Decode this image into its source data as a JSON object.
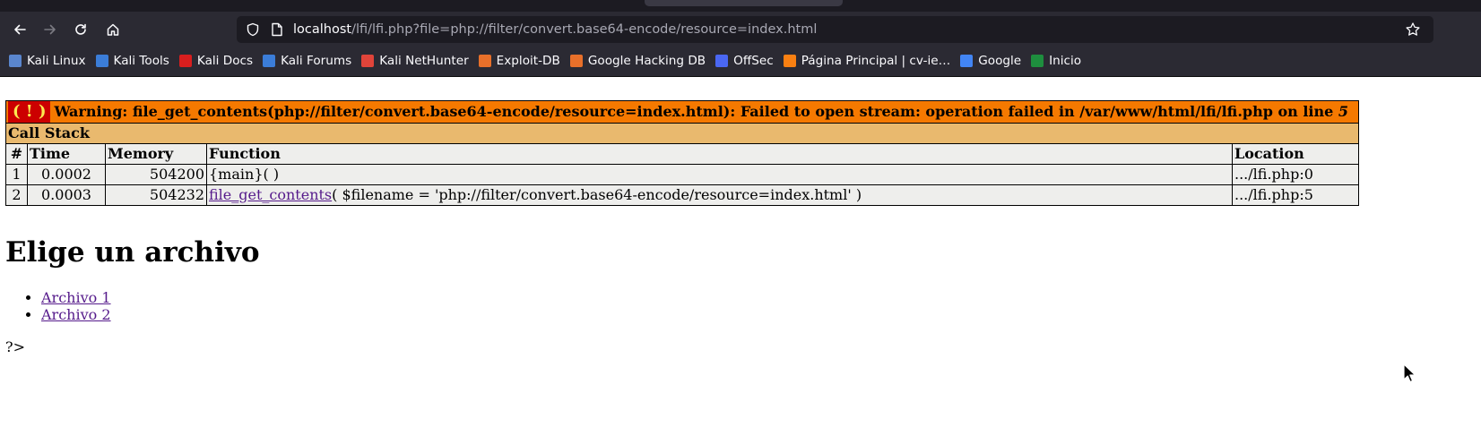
{
  "browser": {
    "url_host": "localhost",
    "url_rest": "/lfi/lfi.php?file=php://filter/convert.base64-encode/resource=index.html",
    "bookmarks": [
      {
        "label": "Kali Linux",
        "icon": "kali-dragon-icon",
        "color": "#5a86ce"
      },
      {
        "label": "Kali Tools",
        "icon": "kali-tools-icon",
        "color": "#3b7dd8"
      },
      {
        "label": "Kali Docs",
        "icon": "kali-docs-icon",
        "color": "#d81e1e"
      },
      {
        "label": "Kali Forums",
        "icon": "kali-forums-icon",
        "color": "#3b7dd8"
      },
      {
        "label": "Kali NetHunter",
        "icon": "nethunter-icon",
        "color": "#e0443a"
      },
      {
        "label": "Exploit-DB",
        "icon": "exploit-db-icon",
        "color": "#e8702a"
      },
      {
        "label": "Google Hacking DB",
        "icon": "ghdb-icon",
        "color": "#e8702a"
      },
      {
        "label": "OffSec",
        "icon": "offsec-icon",
        "color": "#4a67f2"
      },
      {
        "label": "Página Principal | cv-ie…",
        "icon": "moodle-icon",
        "color": "#f98012"
      },
      {
        "label": "Google",
        "icon": "google-icon",
        "color": "#4285f4"
      },
      {
        "label": "Inicio",
        "icon": "classroom-icon",
        "color": "#1e8e3e"
      }
    ]
  },
  "error": {
    "badge": "( ! )",
    "warning_prefix": "Warning: file_get_contents(php://filter/convert.base64-encode/resource=index.html): Failed to open stream: operation failed in /var/www/html/lfi/lfi.php on line ",
    "line_number": "5",
    "callstack_label": "Call Stack",
    "columns": [
      "#",
      "Time",
      "Memory",
      "Function",
      "Location"
    ],
    "rows": [
      {
        "num": "1",
        "time": "0.0002",
        "memory": "504200",
        "func_link": "",
        "func_text": "{main}( )",
        "location": ".../lfi.php:0"
      },
      {
        "num": "2",
        "time": "0.0003",
        "memory": "504232",
        "func_link": "file_get_contents",
        "func_text": "( $filename = 'php://filter/convert.base64-encode/resource=index.html' )",
        "location": ".../lfi.php:5"
      }
    ]
  },
  "page": {
    "heading": "Elige un archivo",
    "links": [
      "Archivo 1",
      "Archivo 2"
    ],
    "tail": "?>"
  }
}
